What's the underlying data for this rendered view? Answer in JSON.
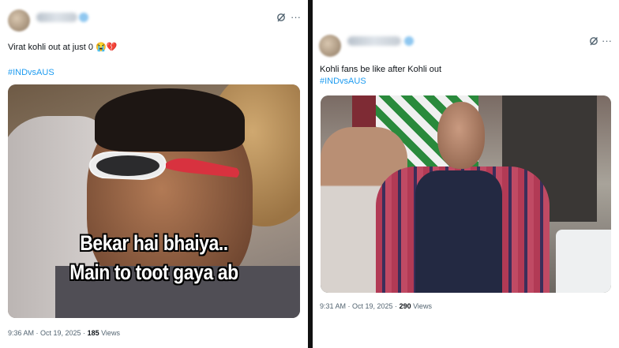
{
  "left_tweet": {
    "author_blurred": true,
    "text": "Virat kohli out at just 0 😭💔",
    "hashtag": "#INDvsAUS",
    "meme_caption_line1": "Bekar hai bhaiya..",
    "meme_caption_line2": "Main to toot gaya ab",
    "timestamp": "9:36 AM · Oct 19, 2025 · ",
    "views_count": "185",
    "views_label": " Views"
  },
  "right_tweet": {
    "author_blurred": true,
    "text": "Kohli fans be like after Kohli out",
    "hashtag": "#INDvsAUS",
    "timestamp": "9:31 AM · Oct 19, 2025 · ",
    "views_count": "290",
    "views_label": " Views"
  },
  "icons": {
    "grok": "grok-icon",
    "more": "more-options-icon",
    "more_glyph": "···"
  },
  "colors": {
    "text": "#0f1419",
    "secondary": "#536471",
    "link": "#1d9bf0",
    "divider": "#111111"
  }
}
